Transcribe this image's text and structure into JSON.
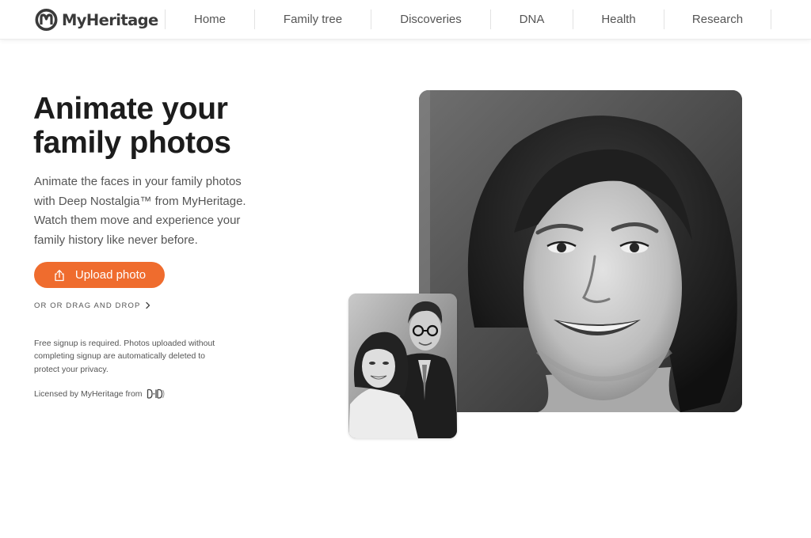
{
  "header": {
    "brand": "MyHeritage",
    "nav": [
      "Home",
      "Family tree",
      "Discoveries",
      "DNA",
      "Health",
      "Research"
    ]
  },
  "hero": {
    "title": "Animate your family photos",
    "description": "Animate the faces in your family photos with Deep Nostalgia™ from MyHeritage. Watch them move and experience your family history like never before.",
    "upload_label": "Upload photo",
    "drag_label": "OR OR DRAG AND DROP",
    "note": "Free signup is required. Photos uploaded without completing signup are automatically deleted to protect your privacy.",
    "licensed_label": "Licensed by MyHeritage from",
    "licensor_logo_text": "D-ID"
  },
  "photos": {
    "main": "black-and-white portrait of a smiling woman",
    "inset": "black-and-white couple portrait"
  },
  "colors": {
    "accent": "#ef6c2e",
    "text": "#1c1c1c",
    "muted": "#555555",
    "logo": "#3a3a3a"
  },
  "icons": {
    "upload": "upload-icon",
    "chevron": "chevron-right-icon",
    "logo": "myheritage-logo-icon"
  }
}
